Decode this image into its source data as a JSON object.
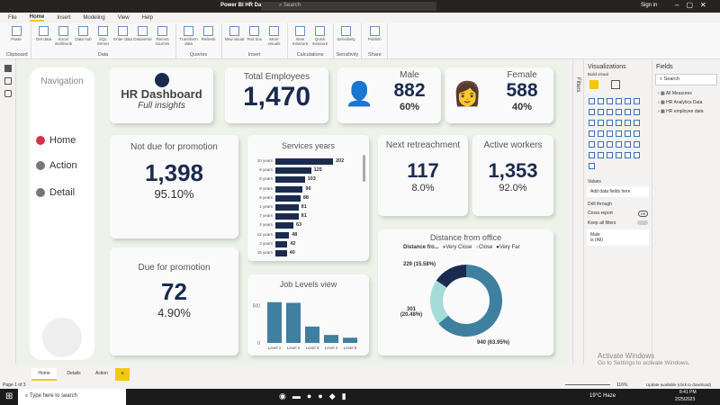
{
  "window": {
    "title": "Power BI HR Dashboard - Power BI Desktop",
    "search_placeholder": "Search",
    "sign_in": "Sign in"
  },
  "menu": [
    "File",
    "Home",
    "Insert",
    "Modeling",
    "View",
    "Help"
  ],
  "ribbon": {
    "items": [
      "Paste",
      "Get data",
      "Excel workbook",
      "Data hub",
      "SQL Server",
      "Enter data",
      "Dataverse",
      "Recent sources",
      "Transform data",
      "Refresh",
      "New visual",
      "Text box",
      "More visuals",
      "New measure",
      "Quick measure",
      "Sensitivity",
      "Publish"
    ],
    "groups": [
      "Clipboard",
      "Data",
      "Queries",
      "Insert",
      "Calculations",
      "Sensitivity",
      "Share"
    ]
  },
  "nav": {
    "title": "Navigation",
    "items": [
      {
        "label": "Home",
        "color": "#d1344a"
      },
      {
        "label": "Action",
        "color": "#777777"
      },
      {
        "label": "Detail",
        "color": "#777777"
      }
    ]
  },
  "header": {
    "title": "HR Dashboard",
    "subtitle": "Full insights"
  },
  "kpis": {
    "total": {
      "label": "Total Employees",
      "value": "1,470"
    },
    "male": {
      "label": "Male",
      "value": "882",
      "pct": "60%"
    },
    "female": {
      "label": "Female",
      "value": "588",
      "pct": "40%"
    },
    "not_due": {
      "label": "Not due for promotion",
      "value": "1,398",
      "pct": "95.10%"
    },
    "due": {
      "label": "Due for promotion",
      "value": "72",
      "pct": "4.90%"
    },
    "retrench": {
      "label": "Next retreachment",
      "value": "117",
      "pct": "8.0%"
    },
    "active": {
      "label": "Active workers",
      "value": "1,353",
      "pct": "92.0%"
    }
  },
  "chart_data": [
    {
      "type": "bar",
      "orientation": "horizontal",
      "title": "Services years",
      "categories": [
        "10 years",
        "6 years",
        "8 years",
        "9 years",
        "5 years",
        "1 years",
        "7 years",
        "4 years",
        "12 years",
        "3 years",
        "15 years"
      ],
      "values": [
        202,
        125,
        103,
        96,
        88,
        81,
        81,
        63,
        48,
        42,
        40
      ]
    },
    {
      "type": "bar",
      "title": "Job Levels view",
      "categories": [
        "Level 1",
        "Level 2",
        "Level 3",
        "Level 4",
        "Level 5"
      ],
      "values": [
        543,
        534,
        218,
        106,
        69
      ],
      "yticks": [
        "500",
        "0"
      ],
      "ylim": [
        0,
        600
      ]
    },
    {
      "type": "pie",
      "title": "Distance from office",
      "legend_title": "Distance fro...",
      "labels": [
        "Very Close",
        "Close",
        "Very Far"
      ],
      "values": [
        940,
        301,
        229
      ],
      "data_labels": [
        "940 (63.95%)",
        "301 (20.48%)",
        "229 (15.58%)"
      ],
      "colors": [
        "#3f7fa0",
        "#a5dcd7",
        "#1b2b4f"
      ]
    }
  ],
  "viz_panel": {
    "title": "Visualizations",
    "build": "Build visual",
    "values": "Values",
    "add_fields": "Add data fields here",
    "drill": "Drill through",
    "cross": "Cross-report",
    "cross_state": "Off",
    "keep": "Keep all filters",
    "filter_field": "Male",
    "filter_value": "is (All)"
  },
  "filters_label": "Filters",
  "fields_panel": {
    "title": "Fields",
    "search": "Search",
    "tables": [
      "All Measures",
      "HR Analytics Data",
      "HR employee data"
    ]
  },
  "pages": {
    "tabs": [
      "Home",
      "Details",
      "Action"
    ],
    "add": "+",
    "status": "Page 1 of 3"
  },
  "status": {
    "zoom": "116%",
    "update": "Update available (click to download)",
    "watermark": "Activate Windows",
    "watermark2": "Go to Settings to activate Windows."
  },
  "taskbar": {
    "search": "Type here to search",
    "weather": "19°C Haze",
    "time": "8:41 PM",
    "date": "2/25/2023"
  }
}
